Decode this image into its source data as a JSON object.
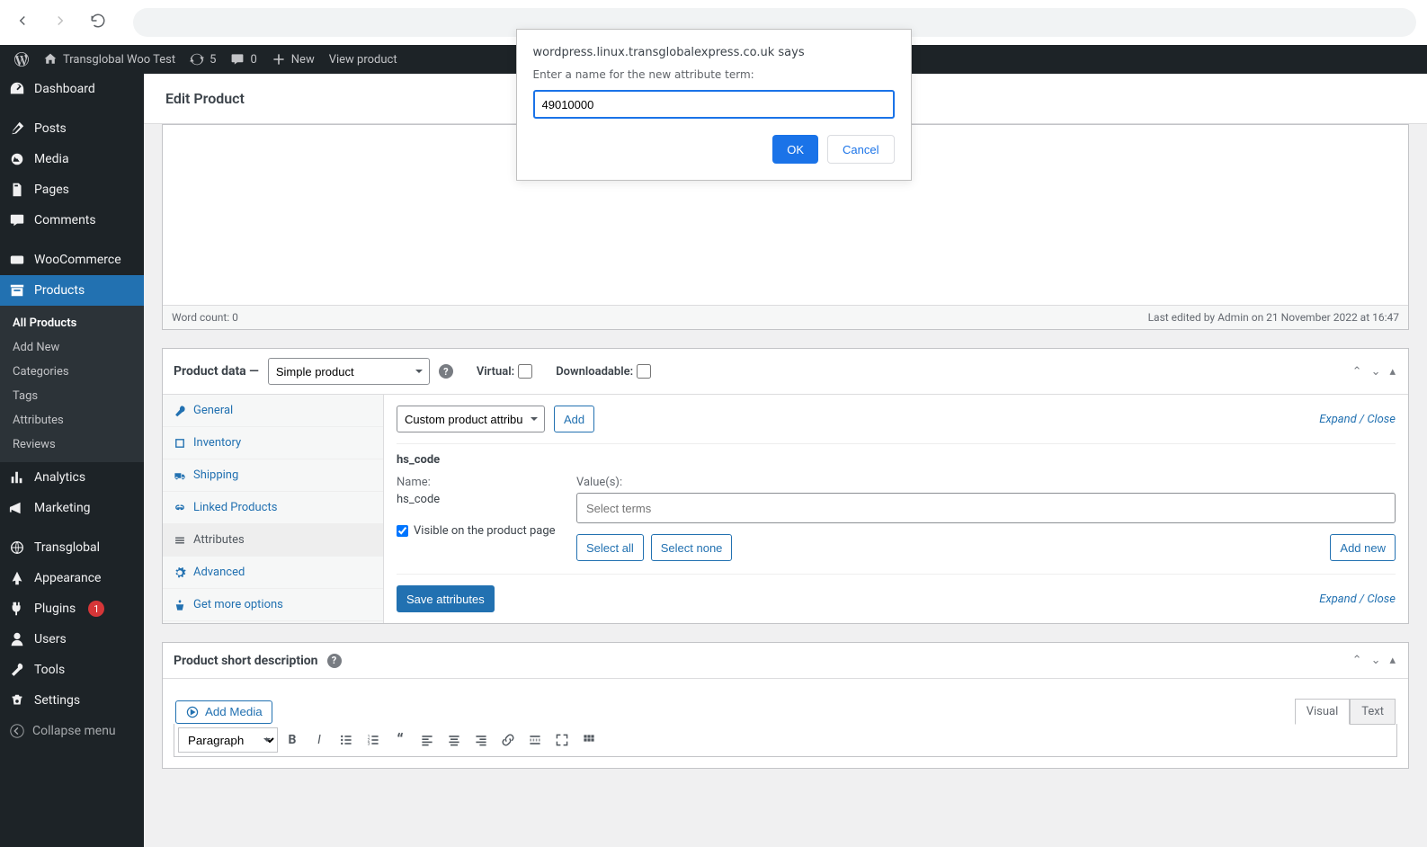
{
  "browser": {},
  "adminbar": {
    "site_name": "Transglobal Woo Test",
    "updates": "5",
    "comments": "0",
    "new_label": "New",
    "view_product": "View product"
  },
  "sidebar": {
    "items": [
      {
        "label": "Dashboard"
      },
      {
        "label": "Posts"
      },
      {
        "label": "Media"
      },
      {
        "label": "Pages"
      },
      {
        "label": "Comments"
      },
      {
        "label": "WooCommerce"
      },
      {
        "label": "Products"
      },
      {
        "label": "Analytics"
      },
      {
        "label": "Marketing"
      },
      {
        "label": "Transglobal"
      },
      {
        "label": "Appearance"
      },
      {
        "label": "Plugins"
      },
      {
        "label": "Users"
      },
      {
        "label": "Tools"
      },
      {
        "label": "Settings"
      }
    ],
    "plugins_badge": "1",
    "submenu": {
      "all": "All Products",
      "add": "Add New",
      "categories": "Categories",
      "tags": "Tags",
      "attributes": "Attributes",
      "reviews": "Reviews"
    },
    "collapse": "Collapse menu"
  },
  "page": {
    "title": "Edit Product",
    "word_count": "Word count: 0",
    "last_edited": "Last edited by Admin on 21 November 2022 at 16:47"
  },
  "product_data": {
    "heading": "Product data",
    "dash": "—",
    "type_selected": "Simple product",
    "virtual_label": "Virtual:",
    "downloadable_label": "Downloadable:",
    "tabs": {
      "general": "General",
      "inventory": "Inventory",
      "shipping": "Shipping",
      "linked": "Linked Products",
      "attributes": "Attributes",
      "advanced": "Advanced",
      "get_more": "Get more options"
    },
    "attr_select": "Custom product attribute",
    "add_btn": "Add",
    "expand_close": "Expand / Close",
    "attribute": {
      "title": "hs_code",
      "name_label": "Name:",
      "name_value": "hs_code",
      "visible_label": "Visible on the product page",
      "values_label": "Value(s):",
      "terms_placeholder": "Select terms",
      "select_all": "Select all",
      "select_none": "Select none",
      "add_new": "Add new"
    },
    "save_btn": "Save attributes"
  },
  "short_desc": {
    "heading": "Product short description",
    "add_media": "Add Media",
    "visual_tab": "Visual",
    "text_tab": "Text",
    "format_select": "Paragraph"
  },
  "modal": {
    "title": "wordpress.linux.transglobalexpress.co.uk says",
    "prompt": "Enter a name for the new attribute term:",
    "value": "49010000",
    "ok": "OK",
    "cancel": "Cancel"
  }
}
